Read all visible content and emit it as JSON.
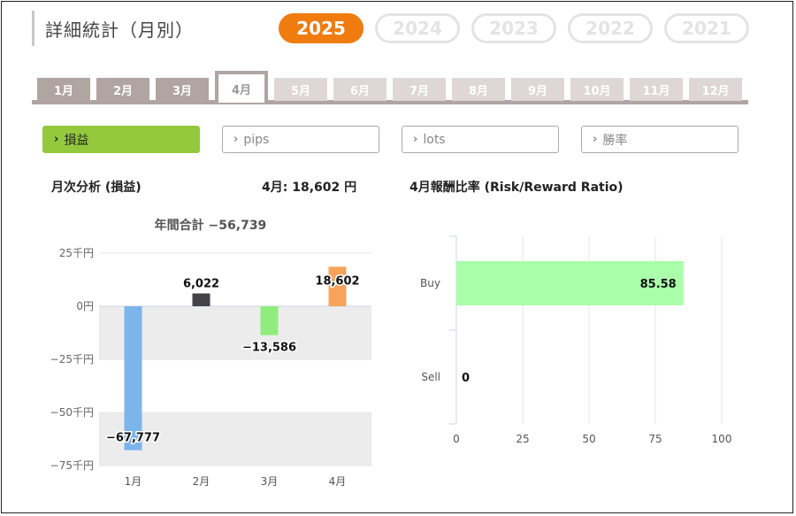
{
  "header": {
    "title": "詳細統計（月別）",
    "years": [
      {
        "label": "2025",
        "active": true
      },
      {
        "label": "2024",
        "active": false
      },
      {
        "label": "2023",
        "active": false
      },
      {
        "label": "2022",
        "active": false
      },
      {
        "label": "2021",
        "active": false
      }
    ]
  },
  "months": [
    {
      "label": "1月",
      "state": "normal"
    },
    {
      "label": "2月",
      "state": "normal"
    },
    {
      "label": "3月",
      "state": "normal"
    },
    {
      "label": "4月",
      "state": "active"
    },
    {
      "label": "5月",
      "state": "dim"
    },
    {
      "label": "6月",
      "state": "dim"
    },
    {
      "label": "7月",
      "state": "dim"
    },
    {
      "label": "8月",
      "state": "dim"
    },
    {
      "label": "9月",
      "state": "dim"
    },
    {
      "label": "10月",
      "state": "dim"
    },
    {
      "label": "11月",
      "state": "dim"
    },
    {
      "label": "12月",
      "state": "dim"
    }
  ],
  "metrics": [
    {
      "label": "損益",
      "active": true
    },
    {
      "label": "pips",
      "active": false
    },
    {
      "label": "lots",
      "active": false
    },
    {
      "label": "勝率",
      "active": false
    }
  ],
  "colors": {
    "accent_orange": "#f07c10",
    "metric_active": "#95c93d",
    "tab": "#b0a5a3",
    "tab_dim": "#ded7d6"
  },
  "left": {
    "section_title": "月次分析 (損益)",
    "month_total": "4月:  18,602 円"
  },
  "right": {
    "section_title": "4月報酬比率 (Risk/Reward Ratio)"
  },
  "chart_data": [
    {
      "type": "bar",
      "title": "年間合計 −56,739",
      "categories": [
        "1月",
        "2月",
        "3月",
        "4月"
      ],
      "values": [
        -67777,
        6022,
        -13586,
        18602
      ],
      "data_labels": [
        "−67,777",
        "6,022",
        "−13,586",
        "18,602"
      ],
      "bar_colors": [
        "#7cb5ec",
        "#434348",
        "#90ed7d",
        "#f7a35c"
      ],
      "ylim": [
        -75000,
        25000
      ],
      "yticks": [
        {
          "value": 25000,
          "label": "25千円"
        },
        {
          "value": 0,
          "label": "0円"
        },
        {
          "value": -25000,
          "label": "−25千円"
        },
        {
          "value": -50000,
          "label": "−50千円"
        },
        {
          "value": -75000,
          "label": "−75千円"
        }
      ],
      "grid": "alternating bands",
      "xlabel": "",
      "ylabel": ""
    },
    {
      "type": "bar",
      "orientation": "horizontal",
      "title": "",
      "categories": [
        "Buy",
        "Sell"
      ],
      "values": [
        85.58,
        0
      ],
      "data_labels": [
        "85.58",
        "0"
      ],
      "bar_color": "#aaffaa",
      "xlim": [
        0,
        100
      ],
      "xticks": [
        "0",
        "25",
        "50",
        "75",
        "100"
      ],
      "grid": "vertical lines",
      "xlabel": "",
      "ylabel": ""
    }
  ]
}
